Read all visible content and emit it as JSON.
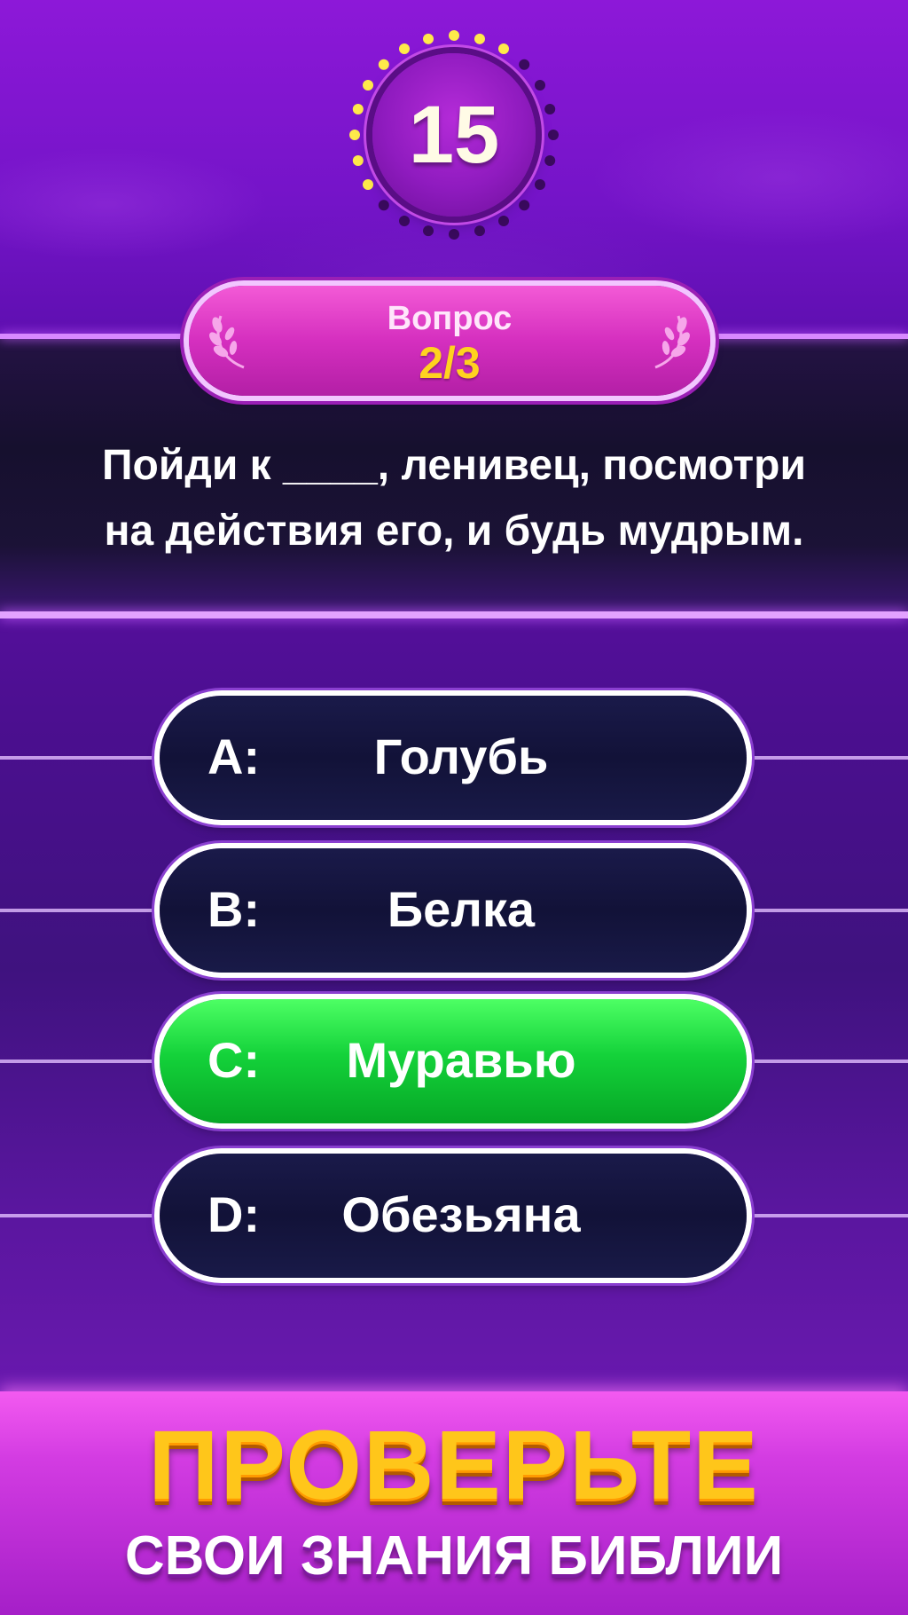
{
  "timer": {
    "value": "15",
    "dots_total": 24,
    "dots_lit": 11,
    "lit_color": "#ffe94a",
    "unlit_color": "#3a0a5e"
  },
  "question": {
    "label": "Вопрос",
    "counter": "2/3",
    "line1": "Пойди к ____, ленивец, посмотри",
    "line2": "на действия его, и будь мудрым."
  },
  "answers": [
    {
      "letter": "A:",
      "text": "Голубь",
      "state": "normal"
    },
    {
      "letter": "B:",
      "text": "Белка",
      "state": "normal"
    },
    {
      "letter": "C:",
      "text": "Муравью",
      "state": "correct"
    },
    {
      "letter": "D:",
      "text": "Обезьяна",
      "state": "normal"
    }
  ],
  "banner": {
    "title": "ПРОВЕРЬТЕ",
    "subtitle": "СВОИ ЗНАНИЯ БИБЛИИ"
  },
  "colors": {
    "correct": "#14d23a",
    "badge": "#d52fbf",
    "counter": "#ffd21f"
  }
}
